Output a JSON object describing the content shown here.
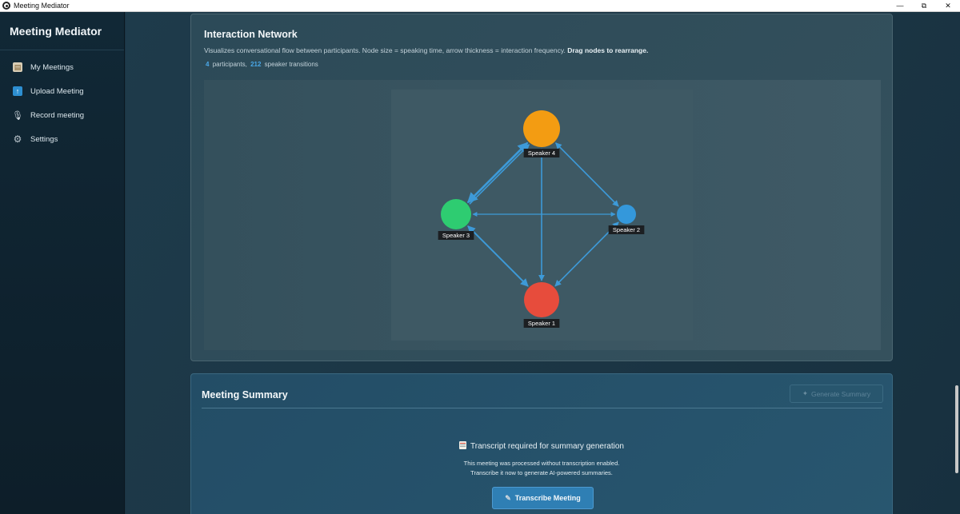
{
  "window": {
    "title": "Meeting Mediator",
    "controls": {
      "minimize": "—",
      "maximize": "⧉",
      "close": "✕"
    }
  },
  "sidebar": {
    "brand": "Meeting Mediator",
    "items": [
      {
        "label": "My Meetings",
        "icon": "clipboard-icon"
      },
      {
        "label": "Upload Meeting",
        "icon": "upload-icon"
      },
      {
        "label": "Record meeting",
        "icon": "microphone-icon"
      },
      {
        "label": "Settings",
        "icon": "gear-icon"
      }
    ]
  },
  "network": {
    "title": "Interaction Network",
    "description": "Visualizes conversational flow between participants. Node size = speaking time, arrow thickness = interaction frequency.",
    "description_bold": "Drag nodes to rearrange.",
    "participants_count": "4",
    "participants_label": "participants,",
    "transitions_count": "212",
    "transitions_label": "speaker transitions",
    "nodes": [
      {
        "id": "s4",
        "label": "Speaker 4",
        "color": "#f39c12"
      },
      {
        "id": "s3",
        "label": "Speaker 3",
        "color": "#2ecc71"
      },
      {
        "id": "s2",
        "label": "Speaker 2",
        "color": "#3498db"
      },
      {
        "id": "s1",
        "label": "Speaker 1",
        "color": "#e74c3c"
      }
    ],
    "edge_color": "#3d9ad8"
  },
  "summary": {
    "title": "Meeting Summary",
    "generate_label": "Generate Summary",
    "required_text": "Transcript required for summary generation",
    "note_line1": "This meeting was processed without transcription enabled.",
    "note_line2": "Transcribe it now to generate AI-powered summaries.",
    "transcribe_label": "Transcribe Meeting"
  }
}
